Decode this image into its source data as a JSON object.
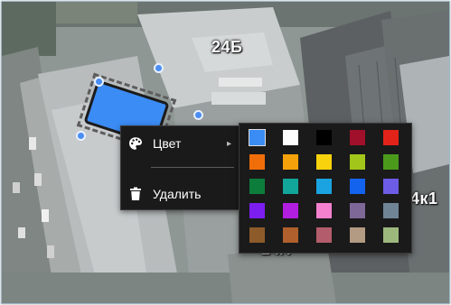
{
  "map": {
    "labels": {
      "building_24b": "24Б",
      "building_4k1": "4к1",
      "building_partial": "24/7"
    }
  },
  "context_menu": {
    "color_label": "Цвет",
    "color_icon": "palette-icon",
    "submenu_arrow": "▸",
    "delete_label": "Удалить",
    "delete_icon": "trash-icon"
  },
  "shape": {
    "fill_color": "#3b8cf5",
    "stroke_color": "#1b1b1b"
  },
  "color_palette": {
    "rows": [
      [
        "#3b8cf5",
        "#ffffff",
        "#000000",
        "#a0102a",
        "#e2231a"
      ],
      [
        "#f06e0a",
        "#f5a10a",
        "#f8d20c",
        "#a2c61a",
        "#4c9a1c"
      ],
      [
        "#0d7d3c",
        "#12a59a",
        "#1aa3e0",
        "#1463ee",
        "#6c5ce6"
      ],
      [
        "#7c1ef0",
        "#b21ee0",
        "#f480d0",
        "#7e6898",
        "#6f8595"
      ],
      [
        "#8d5b2a",
        "#b0602c",
        "#b35d6c",
        "#b39a83",
        "#9db87d"
      ]
    ],
    "selected": "#3b8cf5"
  }
}
